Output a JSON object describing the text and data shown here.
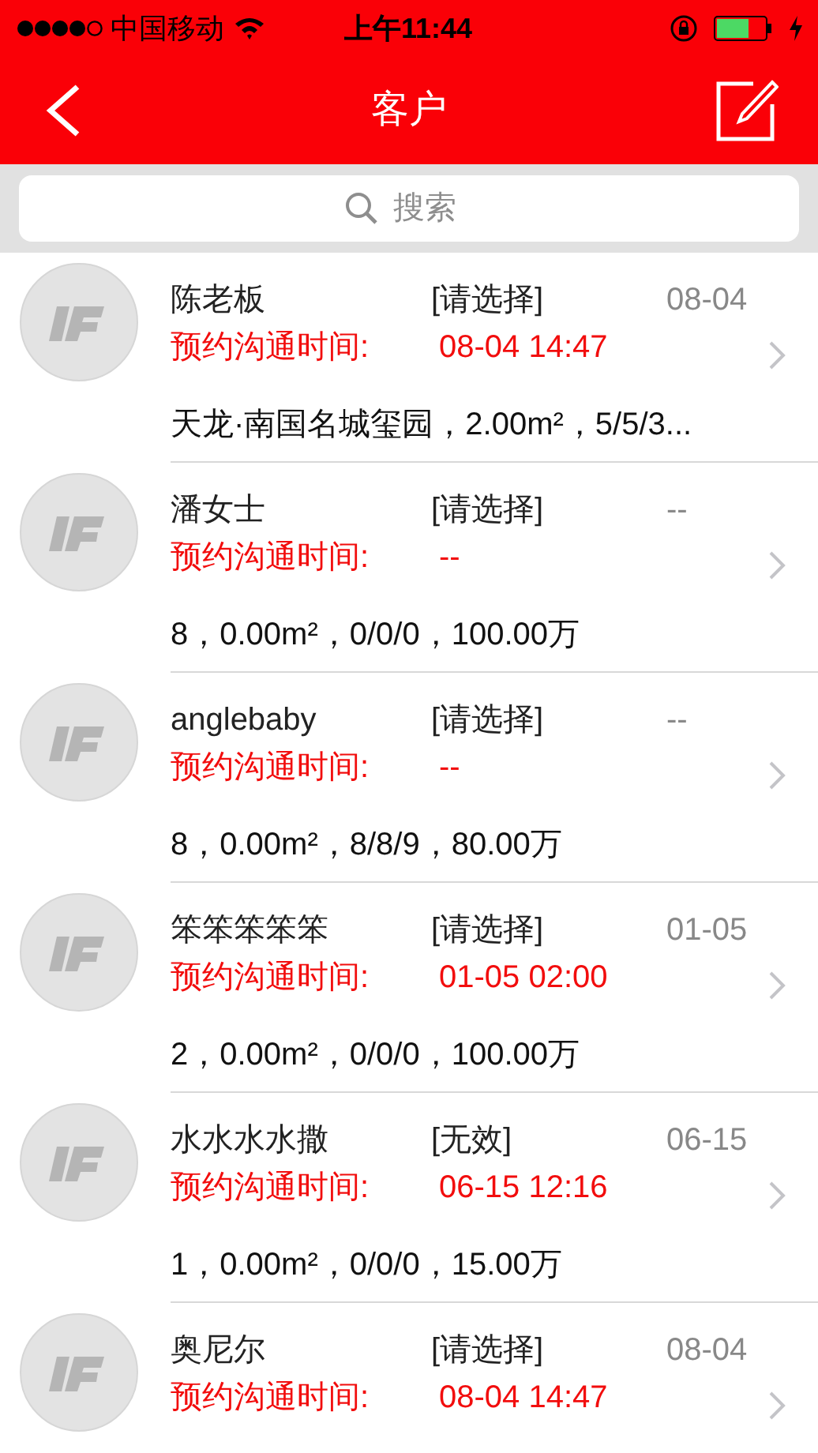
{
  "status_bar": {
    "carrier": "中国移动",
    "time": "上午11:44"
  },
  "nav": {
    "title": "客户"
  },
  "search": {
    "placeholder": "搜索"
  },
  "customers": [
    {
      "name": "陈老板",
      "status": "[请选择]",
      "date": "08-04",
      "time_label": "预约沟通时间:",
      "time": "08-04 14:47",
      "details": "天龙·南国名城玺园，2.00m²，5/5/3..."
    },
    {
      "name": "潘女士",
      "status": "[请选择]",
      "date": "--",
      "time_label": "预约沟通时间:",
      "time": "--",
      "details": "8，0.00m²，0/0/0，100.00万"
    },
    {
      "name": "anglebaby",
      "status": "[请选择]",
      "date": "--",
      "time_label": "预约沟通时间:",
      "time": "--",
      "details": "8，0.00m²，8/8/9，80.00万"
    },
    {
      "name": "笨笨笨笨笨",
      "status": "[请选择]",
      "date": "01-05",
      "time_label": "预约沟通时间:",
      "time": "01-05 02:00",
      "details": "2，0.00m²，0/0/0，100.00万"
    },
    {
      "name": "水水水水撒",
      "status": "[无效]",
      "date": "06-15",
      "time_label": "预约沟通时间:",
      "time": "06-15 12:16",
      "details": "1，0.00m²，0/0/0，15.00万"
    },
    {
      "name": "奥尼尔",
      "status": "[请选择]",
      "date": "08-04",
      "time_label": "预约沟通时间:",
      "time": "08-04 14:47"
    }
  ]
}
